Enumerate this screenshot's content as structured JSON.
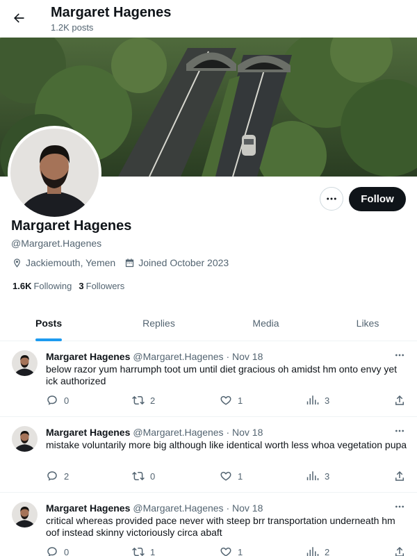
{
  "header": {
    "title": "Margaret Hagenes",
    "post_count": "1.2K posts"
  },
  "profile": {
    "name": "Margaret Hagenes",
    "handle": "@Margaret.Hagenes",
    "location": "Jackiemouth, Yemen",
    "joined": "Joined October 2023",
    "following_count": "1.6K",
    "following_label": "Following",
    "followers_count": "3",
    "followers_label": "Followers",
    "follow_label": "Follow"
  },
  "tabs": [
    {
      "label": "Posts",
      "active": true
    },
    {
      "label": "Replies",
      "active": false
    },
    {
      "label": "Media",
      "active": false
    },
    {
      "label": "Likes",
      "active": false
    }
  ],
  "posts": [
    {
      "name": "Margaret Hagenes",
      "handle": "@Margaret.Hagenes",
      "date": "· Nov 18",
      "text": "below razor yum harrumph toot um until diet gracious oh amidst hm onto envy yet ick authorized",
      "replies": "0",
      "reposts": "2",
      "likes": "1",
      "views": "3"
    },
    {
      "name": "Margaret Hagenes",
      "handle": "@Margaret.Hagenes",
      "date": "· Nov 18",
      "text": "mistake voluntarily more big although like identical worth less whoa vegetation pupa",
      "replies": "2",
      "reposts": "0",
      "likes": "1",
      "views": "3"
    },
    {
      "name": "Margaret Hagenes",
      "handle": "@Margaret.Hagenes",
      "date": "· Nov 18",
      "text": "critical whereas provided pace never with steep brr transportation underneath hm oof instead skinny victoriously circa abaft",
      "replies": "0",
      "reposts": "1",
      "likes": "1",
      "views": "2"
    }
  ],
  "icons": {
    "back": "arrow-left-icon",
    "more": "more-horizontal-icon",
    "location": "location-pin-icon",
    "calendar": "calendar-icon",
    "reply": "reply-bubble-icon",
    "repost": "repost-icon",
    "like": "heart-icon",
    "views": "views-chart-icon",
    "share": "share-icon"
  },
  "colors": {
    "accent": "#1d9bf0",
    "text_primary": "#0f1419",
    "text_secondary": "#536471",
    "follow_button": "#0f1419"
  }
}
